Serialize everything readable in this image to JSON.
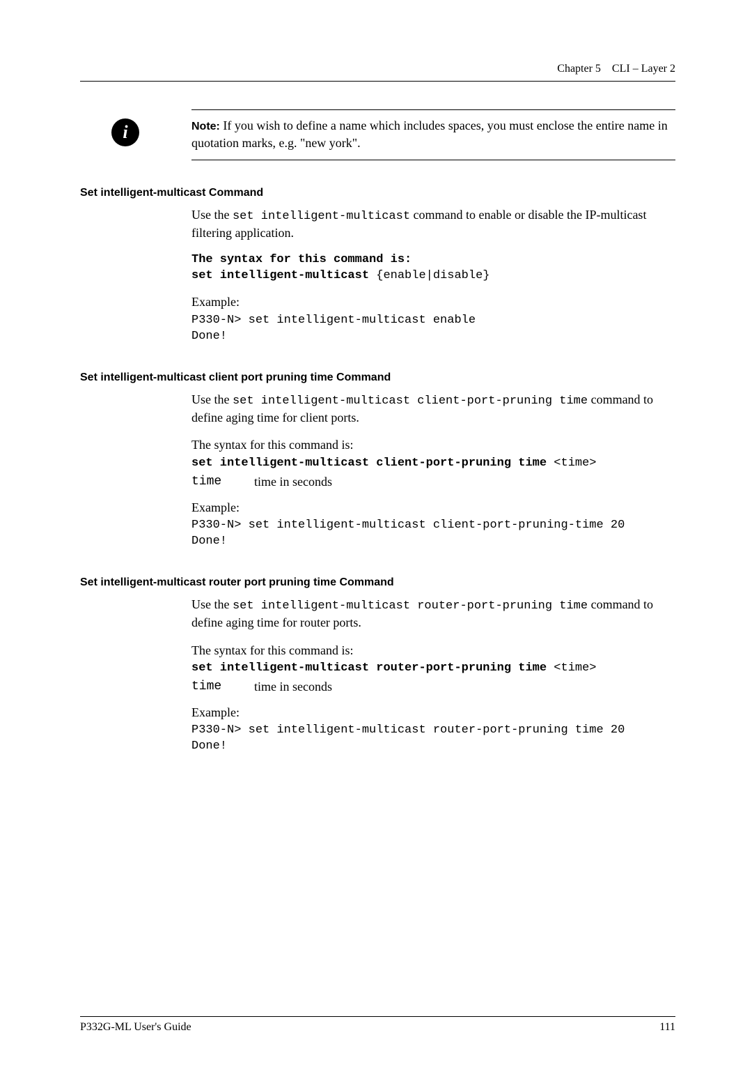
{
  "header": {
    "chapter": "Chapter 5",
    "title": "CLI – Layer 2"
  },
  "note": {
    "label": "Note:",
    "text": "If you wish to define a name which includes spaces, you must enclose the entire name in quotation marks, e.g. \"new york\"."
  },
  "sections": [
    {
      "heading": "Set intelligent-multicast Command",
      "intro_pre": "Use the ",
      "intro_cmd": "set intelligent-multicast",
      "intro_post": " command to enable or disable the IP-multicast filtering application.",
      "syntax_lead_bold": "The syntax for this command is:",
      "syntax_line_bold": "set intelligent-multicast",
      "syntax_line_rest": " {enable|disable}",
      "example_label": "Example:",
      "example_lines": [
        "P330-N> set intelligent-multicast enable",
        "Done!"
      ]
    },
    {
      "heading": "Set intelligent-multicast client port pruning time Command",
      "intro_pre": "Use the ",
      "intro_cmd": "set intelligent-multicast client-port-pruning time",
      "intro_post": " command to define aging time for client ports.",
      "syntax_lead_plain": "The syntax for this command is:",
      "syntax_line_bold": "set intelligent-multicast client-port-pruning time",
      "syntax_line_rest": " <time>",
      "param_name": "time",
      "param_desc": "time in seconds",
      "example_label": "Example:",
      "example_lines": [
        "P330-N> set intelligent-multicast client-port-pruning-time 20",
        "Done!"
      ]
    },
    {
      "heading": "Set intelligent-multicast router port pruning time Command",
      "intro_pre": "Use the ",
      "intro_cmd": "set intelligent-multicast router-port-pruning time",
      "intro_post": " command to define aging time for router ports.",
      "syntax_lead_plain": "The syntax for this command is:",
      "syntax_line_bold": "set intelligent-multicast router-port-pruning time",
      "syntax_line_rest": " <time>",
      "param_name": "time",
      "param_desc": "time in seconds",
      "example_label": "Example:",
      "example_lines": [
        "P330-N> set intelligent-multicast router-port-pruning time 20",
        "Done!"
      ]
    }
  ],
  "footer": {
    "left": "P332G-ML User's Guide",
    "right": "111"
  }
}
